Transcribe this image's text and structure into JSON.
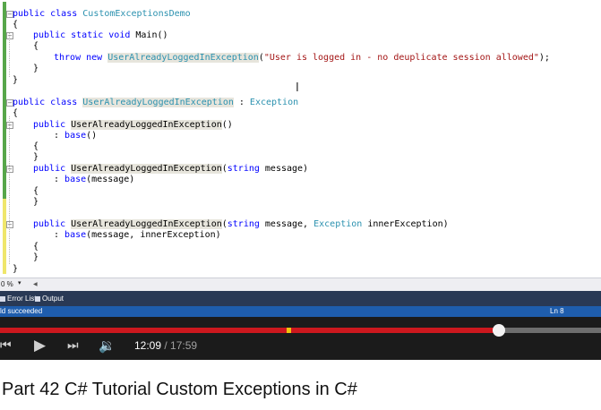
{
  "code": {
    "line1": {
      "kw": "public class ",
      "name": "CustomExceptionsDemo"
    },
    "line2": "{",
    "line3": {
      "kw": "public static void ",
      "rest": "Main()"
    },
    "line4": "{",
    "line5": {
      "kw": "throw new ",
      "type": "UserAlreadyLoggedInException",
      "open": "(",
      "str": "\"User is logged in - no deuplicate session allowed\"",
      "close": ");"
    },
    "line6": "}",
    "line7": "}",
    "line8": {
      "kw": "public class ",
      "name": "UserAlreadyLoggedInException",
      "sep": " : ",
      "base": "Exception"
    },
    "line9": "{",
    "line10": {
      "kw": "public ",
      "name": "UserAlreadyLoggedInException",
      "rest": "()"
    },
    "line11": {
      "prefix": ": ",
      "kw": "base",
      "rest": "()"
    },
    "line12": "{",
    "line13": "}",
    "line14": {
      "kw": "public ",
      "name": "UserAlreadyLoggedInException",
      "open": "(",
      "kw2": "string",
      "rest": " message)"
    },
    "line15": {
      "prefix": ": ",
      "kw": "base",
      "rest": "(message)"
    },
    "line16": "{",
    "line17": "}",
    "line18": {
      "kw": "public ",
      "name": "UserAlreadyLoggedInException",
      "open": "(",
      "kw2": "string",
      "mid": " message, ",
      "type": "Exception",
      "rest": " innerException)"
    },
    "line19": {
      "prefix": ": ",
      "kw": "base",
      "rest": "(message, innerException)"
    },
    "line20": "{",
    "line21": "}",
    "line22": "}"
  },
  "zoom": {
    "level": "0 %",
    "arrow": "▾"
  },
  "panels": {
    "tab1": "Error List",
    "tab2": "Output"
  },
  "status": {
    "text": "ld succeeded",
    "line": "Ln 8"
  },
  "player": {
    "current": "12:09",
    "separator": " / ",
    "duration": "17:59",
    "progress": 0.83,
    "ad_marker": 0.477
  },
  "video": {
    "title": "Part 42 C# Tutorial Custom Exceptions in C#"
  },
  "colors": {
    "keyword": "#0000ff",
    "type": "#2b91af",
    "string": "#a31515",
    "progress": "#cc181e",
    "status_bar": "#1e5dad"
  }
}
